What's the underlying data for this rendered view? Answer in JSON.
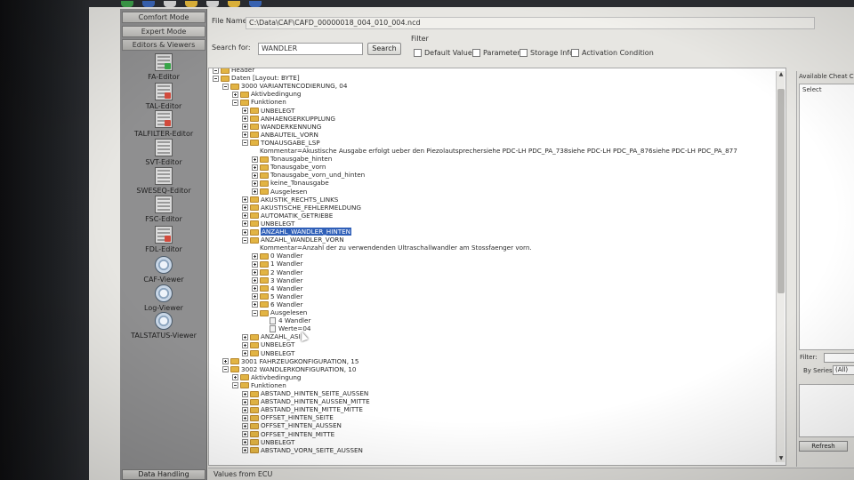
{
  "nav": {
    "modes": [
      "Comfort Mode",
      "Expert Mode",
      "Editors & Viewers"
    ],
    "tools": [
      {
        "label": "FA-Editor",
        "icon": "fa-editor-icon"
      },
      {
        "label": "TAL-Editor",
        "icon": "tal-editor-icon"
      },
      {
        "label": "TALFILTER-Editor",
        "icon": "talfilter-editor-icon"
      },
      {
        "label": "SVT-Editor",
        "icon": "svt-editor-icon"
      },
      {
        "label": "SWESEQ-Editor",
        "icon": "sweseq-editor-icon"
      },
      {
        "label": "FSC-Editor",
        "icon": "fsc-editor-icon"
      },
      {
        "label": "FDL-Editor",
        "icon": "fdl-editor-icon"
      },
      {
        "label": "CAF-Viewer",
        "icon": "caf-viewer-icon"
      },
      {
        "label": "Log-Viewer",
        "icon": "log-viewer-icon"
      },
      {
        "label": "TALSTATUS-Viewer",
        "icon": "talstatus-viewer-icon"
      }
    ],
    "bottom_button": "Data Handling"
  },
  "file": {
    "label": "File Name:",
    "value": "C:\\Data\\CAF\\CAFD_00000018_004_010_004.ncd"
  },
  "search": {
    "label": "Search for:",
    "value": "WANDLER",
    "button": "Search"
  },
  "filter": {
    "title": "Filter",
    "options": [
      "Default Values",
      "Parameter",
      "Storage Info",
      "Activation Condition"
    ]
  },
  "tree": {
    "rows": [
      {
        "text": "Header",
        "level": 0,
        "type": "folder",
        "exp": "minus"
      },
      {
        "text": "Daten [Layout: BYTE]",
        "level": 0,
        "type": "folder",
        "exp": "minus"
      },
      {
        "text": "3000 VARIANTENCODIERUNG, 04",
        "level": 1,
        "type": "folder",
        "exp": "minus"
      },
      {
        "text": "Aktivbedingung",
        "level": 2,
        "type": "folder",
        "exp": "plus"
      },
      {
        "text": "Funktionen",
        "level": 2,
        "type": "folder",
        "exp": "minus"
      },
      {
        "text": "UNBELEGT",
        "level": 3,
        "type": "folder",
        "exp": "plus"
      },
      {
        "text": "ANHAENGERKUPPLUNG",
        "level": 3,
        "type": "folder",
        "exp": "plus"
      },
      {
        "text": "WANDERKENNUNG",
        "level": 3,
        "type": "folder",
        "exp": "plus"
      },
      {
        "text": "ANBAUTEIL_VORN",
        "level": 3,
        "type": "folder",
        "exp": "plus"
      },
      {
        "text": "TONAUSGABE_LSP",
        "level": 3,
        "type": "folder",
        "exp": "minus"
      },
      {
        "text": "Kommentar=Akustische Ausgabe erfolgt ueber den Piezolautsprechersiehe PDC-LH PDC_PA_738siehe PDC-LH PDC_PA_876siehe PDC-LH PDC_PA_877",
        "level": 4,
        "type": "text",
        "exp": "none"
      },
      {
        "text": "Tonausgabe_hinten",
        "level": 4,
        "type": "folder",
        "exp": "plus"
      },
      {
        "text": "Tonausgabe_vorn",
        "level": 4,
        "type": "folder",
        "exp": "plus"
      },
      {
        "text": "Tonausgabe_vorn_und_hinten",
        "level": 4,
        "type": "folder",
        "exp": "plus"
      },
      {
        "text": "keine_Tonausgabe",
        "level": 4,
        "type": "folder",
        "exp": "plus"
      },
      {
        "text": "Ausgelesen",
        "level": 4,
        "type": "folder",
        "exp": "plus"
      },
      {
        "text": "AKUSTIK_RECHTS_LINKS",
        "level": 3,
        "type": "folder",
        "exp": "plus"
      },
      {
        "text": "AKUSTISCHE_FEHLERMELDUNG",
        "level": 3,
        "type": "folder",
        "exp": "plus"
      },
      {
        "text": "AUTOMATIK_GETRIEBE",
        "level": 3,
        "type": "folder",
        "exp": "plus"
      },
      {
        "text": "UNBELEGT",
        "level": 3,
        "type": "folder",
        "exp": "plus"
      },
      {
        "text": "ANZAHL_WANDLER_HINTEN",
        "level": 3,
        "type": "folder",
        "exp": "plus",
        "selected": true
      },
      {
        "text": "ANZAHL_WANDLER_VORN",
        "level": 3,
        "type": "folder",
        "exp": "minus"
      },
      {
        "text": "Kommentar=Anzahl der zu verwendenden Ultraschallwandler am Stossfaenger vorn.",
        "level": 4,
        "type": "text",
        "exp": "none"
      },
      {
        "text": "0 Wandler",
        "level": 4,
        "type": "folder",
        "exp": "plus"
      },
      {
        "text": "1 Wandler",
        "level": 4,
        "type": "folder",
        "exp": "plus"
      },
      {
        "text": "2 Wandler",
        "level": 4,
        "type": "folder",
        "exp": "plus"
      },
      {
        "text": "3 Wandler",
        "level": 4,
        "type": "folder",
        "exp": "plus"
      },
      {
        "text": "4 Wandler",
        "level": 4,
        "type": "folder",
        "exp": "plus"
      },
      {
        "text": "5 Wandler",
        "level": 4,
        "type": "folder",
        "exp": "plus"
      },
      {
        "text": "6 Wandler",
        "level": 4,
        "type": "folder",
        "exp": "plus"
      },
      {
        "text": "Ausgelesen",
        "level": 4,
        "type": "folder",
        "exp": "minus"
      },
      {
        "text": "4 Wandler",
        "level": 5,
        "type": "doc",
        "exp": "none"
      },
      {
        "text": "Werte=04",
        "level": 5,
        "type": "doc",
        "exp": "none"
      },
      {
        "text": "ANZAHL_ASI",
        "level": 3,
        "type": "folder",
        "exp": "plus"
      },
      {
        "text": "UNBELEGT",
        "level": 3,
        "type": "folder",
        "exp": "plus"
      },
      {
        "text": "UNBELEGT",
        "level": 3,
        "type": "folder",
        "exp": "plus"
      },
      {
        "text": "3001 FAHRZEUGKONFIGURATION, 15",
        "level": 1,
        "type": "folder",
        "exp": "plus"
      },
      {
        "text": "3002 WANDLERKONFIGURATION, 10",
        "level": 1,
        "type": "folder",
        "exp": "minus"
      },
      {
        "text": "Aktivbedingung",
        "level": 2,
        "type": "folder",
        "exp": "plus"
      },
      {
        "text": "Funktionen",
        "level": 2,
        "type": "folder",
        "exp": "minus"
      },
      {
        "text": "ABSTAND_HINTEN_SEITE_AUSSEN",
        "level": 3,
        "type": "folder",
        "exp": "plus"
      },
      {
        "text": "ABSTAND_HINTEN_AUSSEN_MITTE",
        "level": 3,
        "type": "folder",
        "exp": "plus"
      },
      {
        "text": "ABSTAND_HINTEN_MITTE_MITTE",
        "level": 3,
        "type": "folder",
        "exp": "plus"
      },
      {
        "text": "OFFSET_HINTEN_SEITE",
        "level": 3,
        "type": "folder",
        "exp": "plus"
      },
      {
        "text": "OFFSET_HINTEN_AUSSEN",
        "level": 3,
        "type": "folder",
        "exp": "plus"
      },
      {
        "text": "OFFSET_HINTEN_MITTE",
        "level": 3,
        "type": "folder",
        "exp": "plus"
      },
      {
        "text": "UNBELEGT",
        "level": 3,
        "type": "folder",
        "exp": "plus"
      },
      {
        "text": "ABSTAND_VORN_SEITE_AUSSEN",
        "level": 3,
        "type": "folder",
        "exp": "plus"
      }
    ]
  },
  "right_panel": {
    "title": "Available Cheat Code",
    "column_header": "Select",
    "filter_label": "Filter:",
    "series_label": "By Series:",
    "series_value": "(All)",
    "refresh_button": "Refresh"
  },
  "status": {
    "text": "Values from ECU"
  },
  "colors": {
    "selection": "#2f5fb8",
    "folder": "#e2b443",
    "panel": "#8f8f90"
  }
}
